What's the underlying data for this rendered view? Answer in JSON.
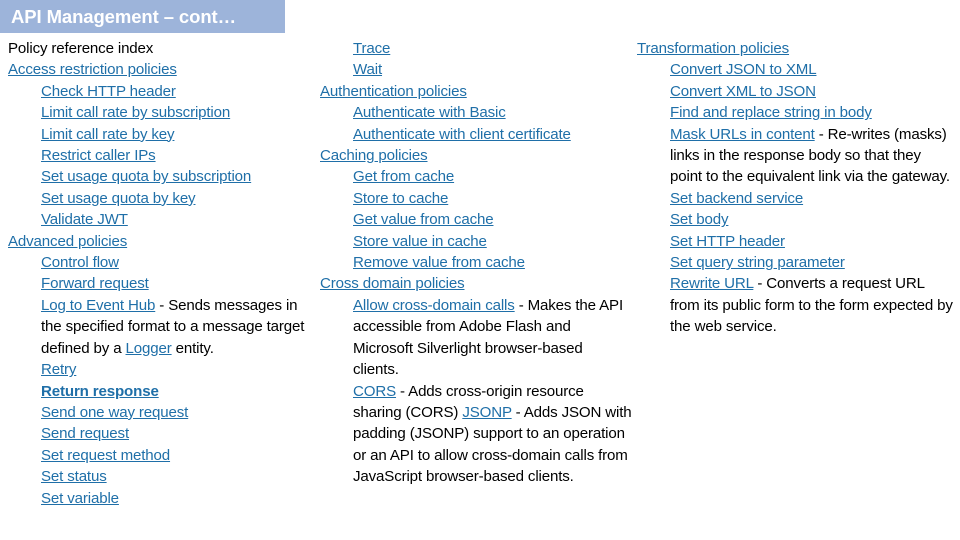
{
  "slide": {
    "title": "API Management – cont…",
    "title_bar_color": "#9DB4DA",
    "link_color": "#1F6FA8",
    "text_color": "#000000",
    "background": "#ffffff"
  },
  "columns": {
    "left": [
      {
        "id": "policy-reference-index",
        "text": "Policy reference index",
        "style": "plain",
        "level": 0
      },
      {
        "id": "access-restriction-policies",
        "text": "Access restriction policies",
        "style": "link",
        "level": 0
      },
      {
        "id": "check-http-header",
        "text": "Check HTTP header",
        "style": "link",
        "level": 1
      },
      {
        "id": "limit-call-rate-by-subscription",
        "text": "Limit call rate by subscription",
        "style": "link",
        "level": 1
      },
      {
        "id": "limit-call-rate-by-key",
        "text": "Limit call rate by key",
        "style": "link",
        "level": 1
      },
      {
        "id": "restrict-caller-ips",
        "text": "Restrict caller IPs",
        "style": "link",
        "level": 1
      },
      {
        "id": "set-usage-quota-by-subscription",
        "text": "Set usage quota by subscription",
        "style": "link",
        "level": 1
      },
      {
        "id": "set-usage-quota-by-key",
        "text": "Set usage quota by key",
        "style": "link",
        "level": 1
      },
      {
        "id": "validate-jwt",
        "text": "Validate JWT",
        "style": "link",
        "level": 1
      },
      {
        "id": "advanced-policies",
        "text": "Advanced policies",
        "style": "link",
        "level": 0
      },
      {
        "id": "control-flow",
        "text": "Control flow",
        "style": "link",
        "level": 1
      },
      {
        "id": "forward-request",
        "text": "Forward request",
        "style": "link",
        "level": 1
      },
      {
        "id": "log-to-event-hub",
        "style": "mixed",
        "level": 1,
        "runs": [
          {
            "t": "Log to Event Hub",
            "k": "link"
          },
          {
            "t": " - Sends messages in the specified format to a message target defined by a ",
            "k": "plain"
          },
          {
            "t": "Logger",
            "k": "link"
          },
          {
            "t": " entity.",
            "k": "plain"
          }
        ]
      },
      {
        "id": "retry",
        "text": "Retry",
        "style": "link",
        "level": 1
      },
      {
        "id": "return-response",
        "text": "Return response",
        "style": "link-bold",
        "level": 1
      },
      {
        "id": "send-one-way-request",
        "text": "Send one way request",
        "style": "link",
        "level": 1
      },
      {
        "id": "send-request",
        "text": "Send request",
        "style": "link",
        "level": 1
      },
      {
        "id": "set-request-method",
        "text": "Set request method",
        "style": "link",
        "level": 1
      },
      {
        "id": "set-status",
        "text": "Set status",
        "style": "link",
        "level": 1
      },
      {
        "id": "set-variable",
        "text": "Set variable",
        "style": "link",
        "level": 1
      }
    ],
    "middle": [
      {
        "id": "trace",
        "text": "Trace",
        "style": "link",
        "level": 1
      },
      {
        "id": "wait",
        "text": "Wait",
        "style": "link",
        "level": 1
      },
      {
        "id": "authentication-policies",
        "text": "Authentication policies",
        "style": "link",
        "level": 0
      },
      {
        "id": "authenticate-with-basic",
        "text": "Authenticate with Basic",
        "style": "link",
        "level": 1
      },
      {
        "id": "authenticate-with-client-certificate",
        "text": "Authenticate with client certificate",
        "style": "link",
        "level": 1
      },
      {
        "id": "caching-policies",
        "text": "Caching policies",
        "style": "link",
        "level": 0
      },
      {
        "id": "get-from-cache",
        "text": "Get from cache",
        "style": "link",
        "level": 1
      },
      {
        "id": "store-to-cache",
        "text": "Store to cache",
        "style": "link",
        "level": 1
      },
      {
        "id": "get-value-from-cache",
        "text": "Get value from cache",
        "style": "link",
        "level": 1
      },
      {
        "id": "store-value-in-cache",
        "text": "Store value in cache",
        "style": "link",
        "level": 1
      },
      {
        "id": "remove-value-from-cache",
        "text": "Remove value from cache",
        "style": "link",
        "level": 1
      },
      {
        "id": "cross-domain-policies",
        "text": "Cross domain policies",
        "style": "link",
        "level": 0
      },
      {
        "id": "allow-cross-domain-calls",
        "style": "mixed",
        "level": 1,
        "runs": [
          {
            "t": "Allow cross-domain calls",
            "k": "link"
          },
          {
            "t": " - Makes the API accessible from Adobe Flash and Microsoft Silverlight browser-based clients.",
            "k": "plain"
          }
        ]
      },
      {
        "id": "cors-jsonp",
        "style": "mixed",
        "level": 1,
        "runs": [
          {
            "t": "CORS",
            "k": "link"
          },
          {
            "t": " - Adds cross-origin resource sharing (CORS) ",
            "k": "plain"
          },
          {
            "t": "JSONP",
            "k": "link"
          },
          {
            "t": " - Adds JSON with padding (JSONP) support to an operation or an API to allow cross-domain calls from JavaScript browser-based clients.",
            "k": "plain"
          }
        ]
      }
    ],
    "right": [
      {
        "id": "transformation-policies",
        "text": "Transformation policies",
        "style": "link",
        "level": 0
      },
      {
        "id": "convert-json-to-xml",
        "text": "Convert JSON to XML",
        "style": "link",
        "level": 1
      },
      {
        "id": "convert-xml-to-json",
        "text": "Convert XML to JSON",
        "style": "link",
        "level": 1
      },
      {
        "id": "find-and-replace-string-in-body",
        "text": "Find and replace string in body",
        "style": "link",
        "level": 1
      },
      {
        "id": "mask-urls-in-content",
        "style": "mixed",
        "level": 1,
        "runs": [
          {
            "t": "Mask URLs in content",
            "k": "link"
          },
          {
            "t": " - Re-writes (masks) links in the response body so that they point to the equivalent link via the gateway.",
            "k": "plain"
          }
        ]
      },
      {
        "id": "set-backend-service",
        "text": "Set backend service",
        "style": "link",
        "level": 1
      },
      {
        "id": "set-body",
        "text": "Set body",
        "style": "link",
        "level": 1
      },
      {
        "id": "set-http-header",
        "text": "Set HTTP header",
        "style": "link",
        "level": 1
      },
      {
        "id": "set-query-string-parameter",
        "text": "Set query string parameter",
        "style": "link",
        "level": 1
      },
      {
        "id": "rewrite-url",
        "style": "mixed",
        "level": 1,
        "runs": [
          {
            "t": "Rewrite URL",
            "k": "link"
          },
          {
            "t": " - Converts a request URL from its public form to the form expected by the web service.",
            "k": "plain"
          }
        ]
      }
    ]
  }
}
